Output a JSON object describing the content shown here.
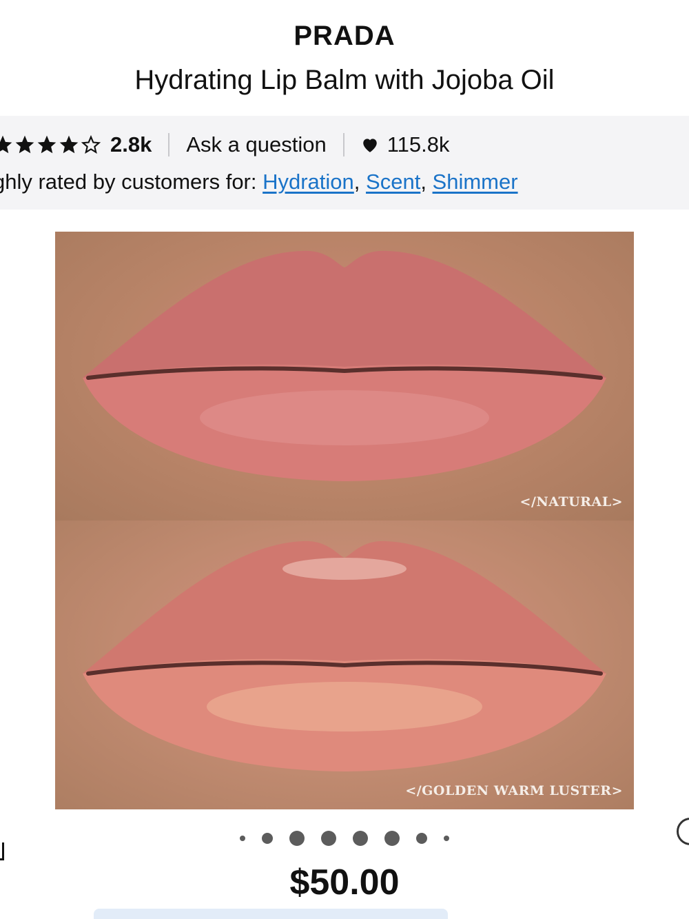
{
  "product": {
    "brand": "PRADA",
    "name": "Hydrating Lip Balm with Jojoba Oil",
    "price": "$50.00"
  },
  "ratings": {
    "stars": 4,
    "max_stars": 5,
    "review_count": "2.8k",
    "ask_label": "Ask a question",
    "loves_count": "115.8k",
    "highly_rated_prefix": "ghly rated by customers for: ",
    "highlights": [
      "Hydration",
      "Scent",
      "Shimmer"
    ]
  },
  "gallery": {
    "shades": [
      {
        "label": "</NATURAL>"
      },
      {
        "label": "</GOLDEN WARM LUSTER>"
      }
    ],
    "dot_count": 8,
    "active_index": 3
  },
  "icons": {
    "star": "star-icon",
    "heart": "heart-icon"
  },
  "colors": {
    "link": "#1a73c8",
    "panel": "#f4f4f6"
  }
}
